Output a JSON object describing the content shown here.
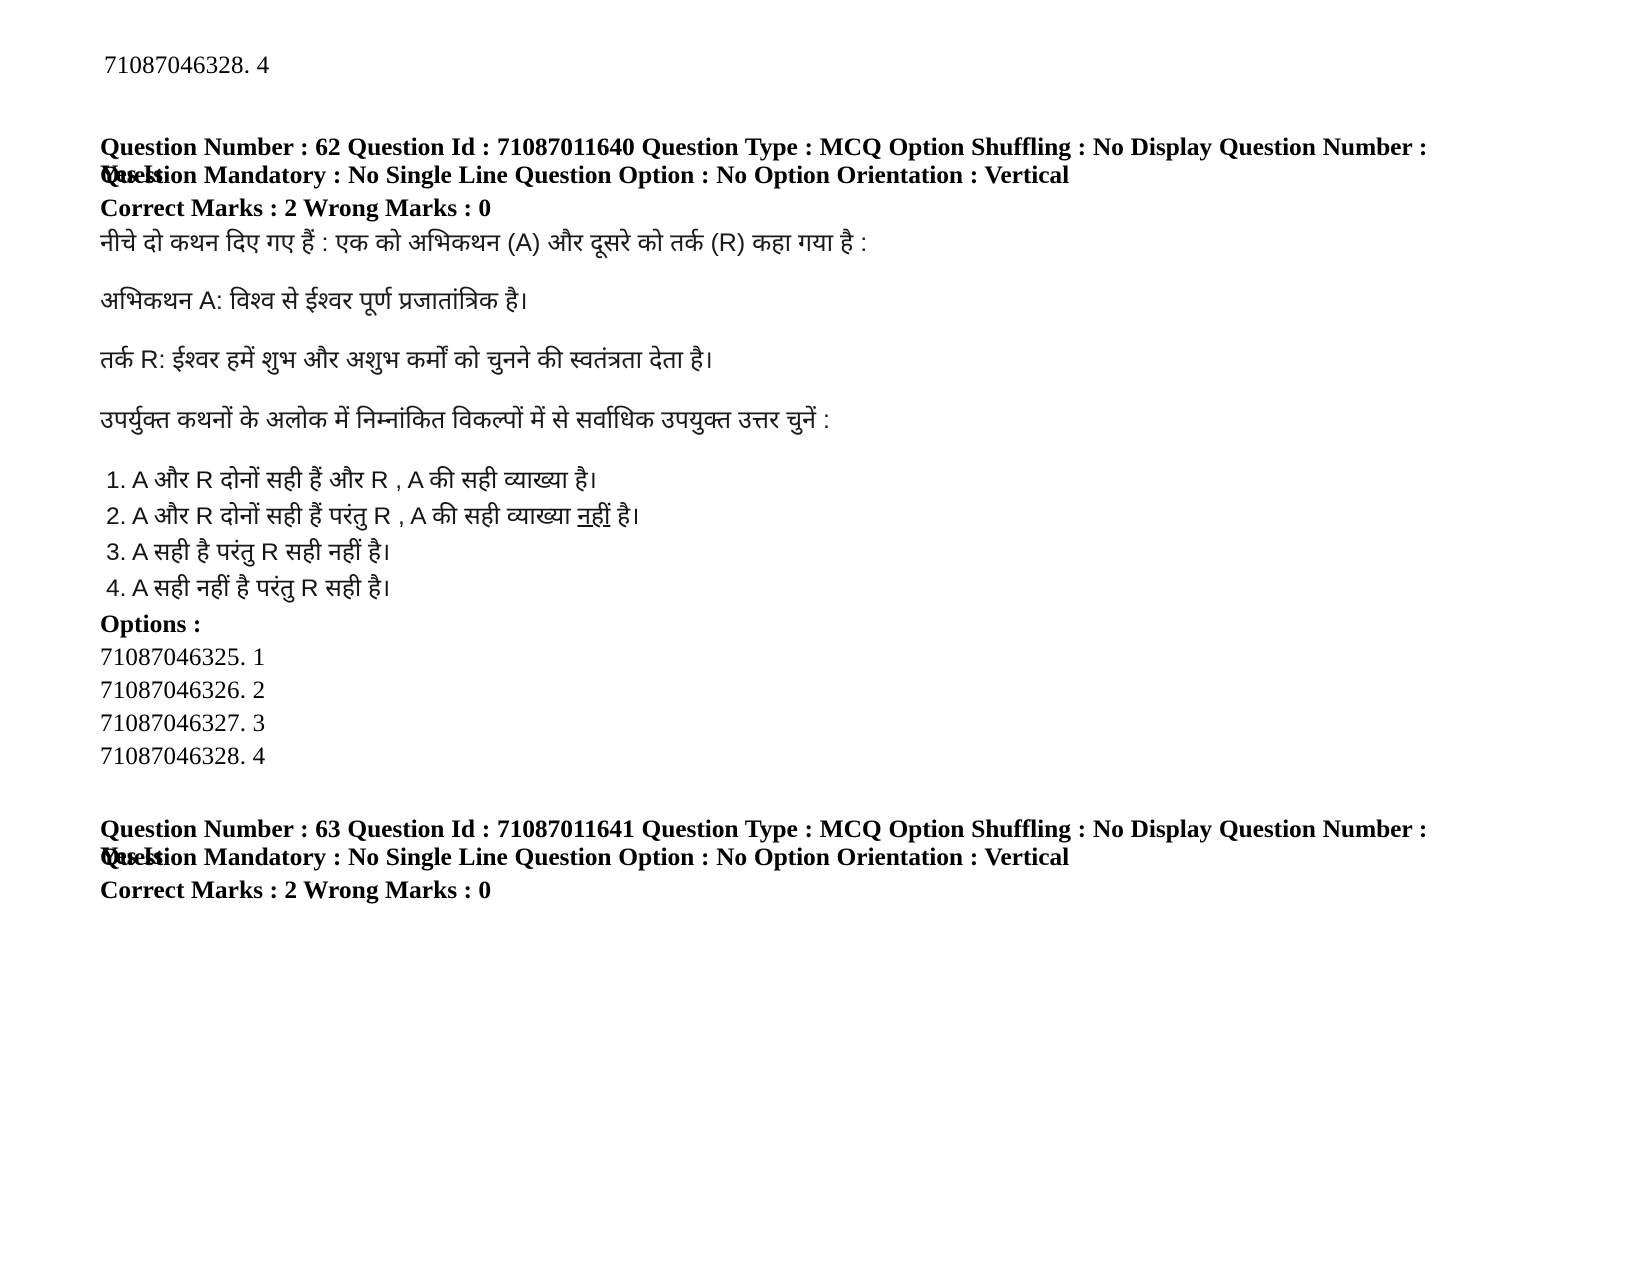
{
  "document": {
    "carryover_option_id": "71087046328. 4"
  },
  "question1": {
    "meta_line1": "Question Number : 62 Question Id : 71087011640 Question Type : MCQ Option Shuffling : No Display Question Number : Yes Is",
    "meta_line2": "Question Mandatory : No Single Line Question Option : No Option Orientation : Vertical",
    "marks_line": "Correct Marks : 2 Wrong Marks : 0",
    "intro": "नीचे दो कथन दिए गए हैं  : एक को अभिकथन (A) और दूसरे को तर्क (R) कहा गया है :",
    "assertion": "अभिकथन A: विश्व से ईश्वर पूर्ण प्रजातांत्रिक है।",
    "reason": "तर्क R: ईश्वर हमें शुभ और अशुभ कर्मों को चुनने की स्वतंत्रता देता है।",
    "prompt": "उपर्युक्त कथनों के अलोक में निम्नांकित विकल्पों में से सर्वाधिक उपयुक्त उत्तर चुनें :",
    "choices": [
      {
        "num": "1.",
        "text_before": "A और R दोनों सही हैं और R , A की सही व्याख्या है।",
        "underline": "",
        "text_after": ""
      },
      {
        "num": "2.",
        "text_before": "A और R दोनों सही हैं परंतु  R , A की सही व्याख्या ",
        "underline": "नहीं",
        "text_after": " है।"
      },
      {
        "num": "3.",
        "text_before": "A सही है परंतु  R  सही नहीं  है।",
        "underline": "",
        "text_after": ""
      },
      {
        "num": "4.",
        "text_before": "A सही नहीं है परंतु R सही है।",
        "underline": "",
        "text_after": ""
      }
    ],
    "options_label": "Options :",
    "option_ids": [
      "71087046325. 1",
      "71087046326. 2",
      "71087046327. 3",
      "71087046328. 4"
    ]
  },
  "question2": {
    "meta_line1": "Question Number : 63 Question Id : 71087011641 Question Type : MCQ Option Shuffling : No Display Question Number : Yes Is",
    "meta_line2": "Question Mandatory : No Single Line Question Option : No Option Orientation : Vertical",
    "marks_line": "Correct Marks : 2 Wrong Marks : 0"
  }
}
